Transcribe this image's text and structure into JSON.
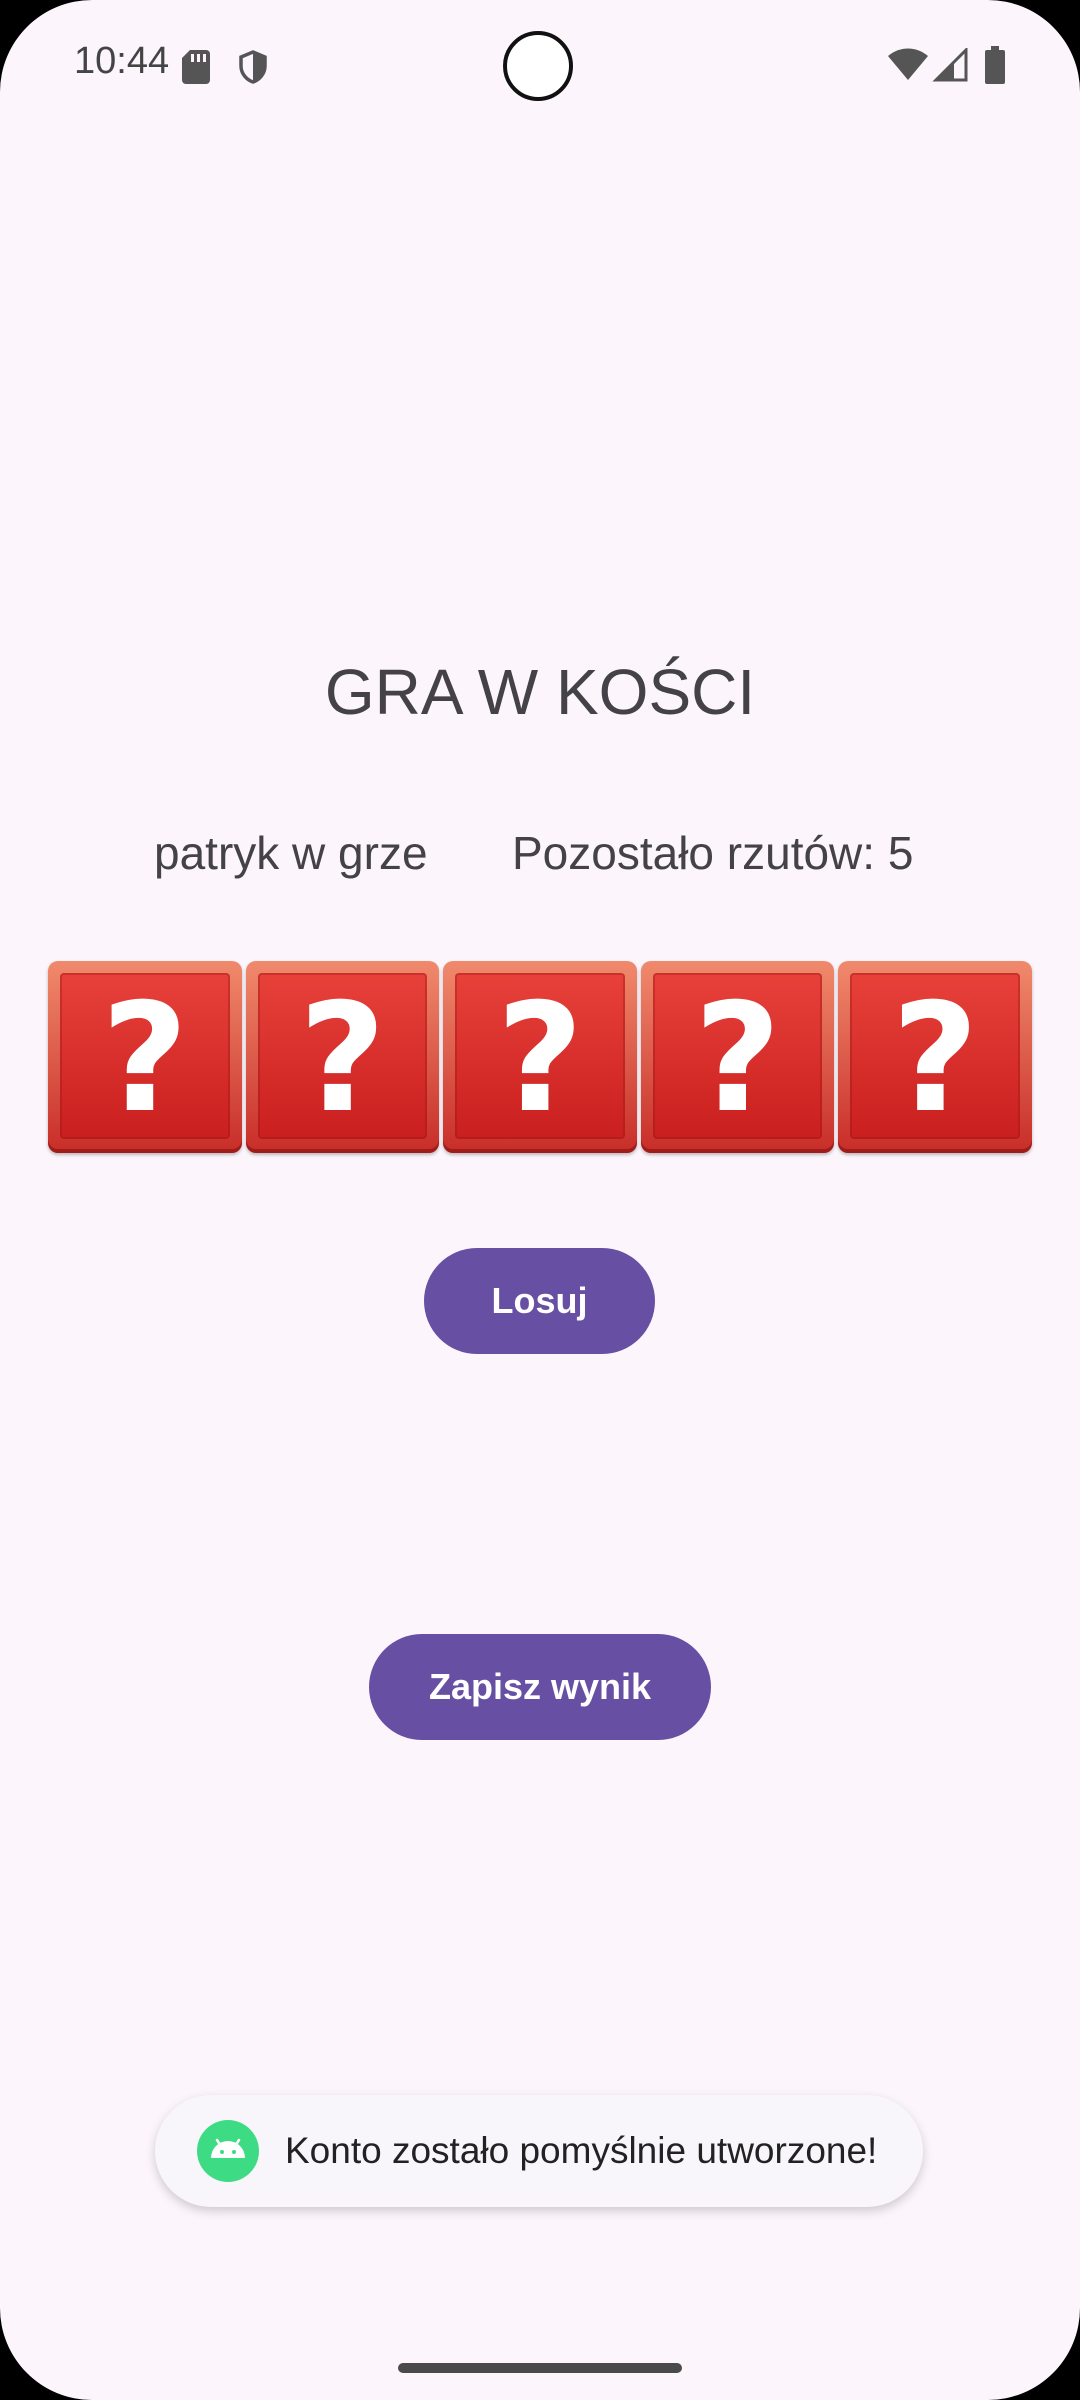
{
  "status_bar": {
    "time": "10:44",
    "icons": [
      "sd-card-icon",
      "shield-icon",
      "wifi-icon",
      "cellular-signal-icon",
      "battery-icon"
    ]
  },
  "game": {
    "title": "GRA W KOŚCI",
    "player_text": "patryk w grze",
    "throws_left_text": "Pozostało rzutów: 5",
    "dice": [
      {
        "face": "?"
      },
      {
        "face": "?"
      },
      {
        "face": "?"
      },
      {
        "face": "?"
      },
      {
        "face": "?"
      }
    ],
    "roll_button_label": "Losuj",
    "save_button_label": "Zapisz wynik"
  },
  "toast": {
    "icon": "android-icon",
    "message": "Konto zostało pomyślnie utworzone!"
  },
  "colors": {
    "background": "#fcf5fc",
    "primary_button": "#6750a4",
    "die_red": "#d9302b",
    "text": "#444248"
  }
}
